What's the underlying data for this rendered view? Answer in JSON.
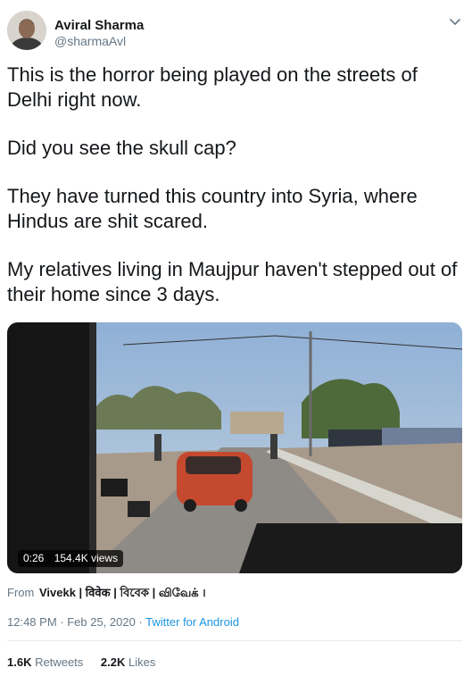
{
  "tweet": {
    "author": {
      "name": "Aviral Sharma",
      "handle": "@sharmaAvl"
    },
    "paragraphs": [
      "This is the horror being played on the streets of Delhi right now.",
      "Did you see the skull cap?",
      "They have turned this country into Syria, where Hindus are shit scared.",
      "My relatives living in Maujpur haven't stepped out of their home since 3 days."
    ],
    "video": {
      "duration": "0:26",
      "views": "154.4K views"
    },
    "attribution": {
      "prefix": "From",
      "source": "Vivekk | विवेक | বিবেক | விவேக் ।"
    },
    "timestamp": "12:48 PM · Feb 25, 2020",
    "separator": "·",
    "client": "Twitter for Android",
    "stats": {
      "retweets": "1.6K",
      "retweets_label": "Retweets",
      "likes": "2.2K",
      "likes_label": "Likes"
    }
  },
  "icons": {
    "menu": "chevron-down-icon",
    "avatar": "profile-photo"
  },
  "colors": {
    "link": "#1b95e0",
    "secondary_text": "#657786",
    "divider": "#e6ecf0"
  }
}
